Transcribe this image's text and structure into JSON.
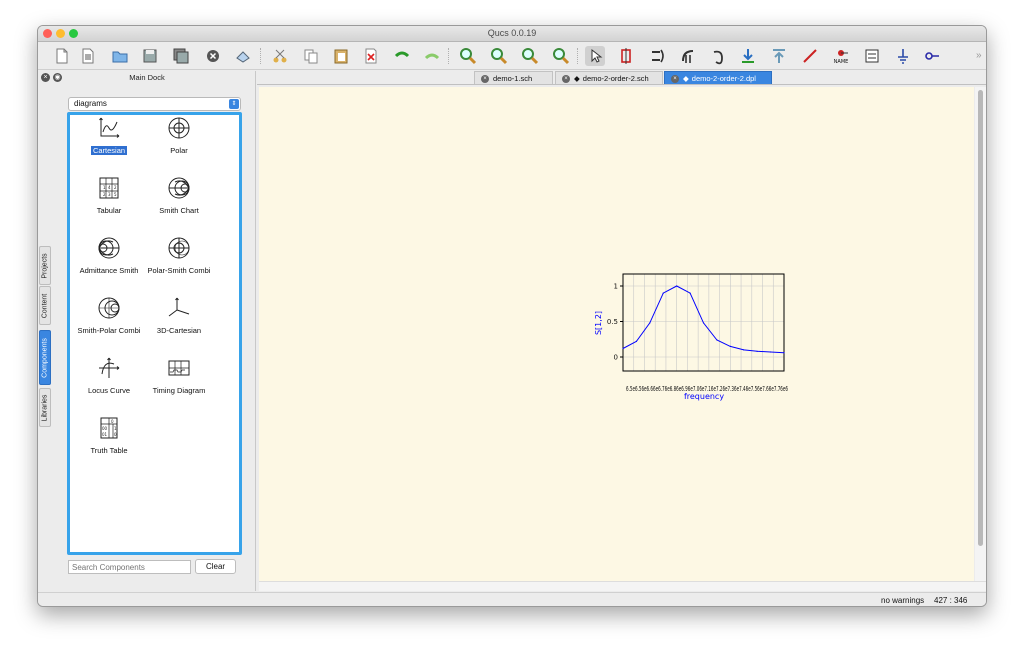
{
  "window": {
    "title": "Qucs 0.0.19"
  },
  "toolbar": {
    "icons": [
      "new-file-icon",
      "new-text-icon",
      "open-icon",
      "save-icon",
      "save-all-icon",
      "close-icon",
      "print-icon",
      "cut-icon",
      "copy-icon",
      "paste-icon",
      "delete-icon",
      "undo-icon",
      "redo-icon",
      "zoom-fit-icon",
      "zoom-1to1-icon",
      "zoom-in-icon",
      "zoom-out-icon",
      "select-icon",
      "port-icon",
      "mirror-x-icon",
      "mirror-y-icon",
      "rotate-icon",
      "enter-subcircuit-icon",
      "exit-subcircuit-icon",
      "wire-icon",
      "name-icon",
      "label-icon",
      "ground-icon",
      "port-symbol-icon"
    ],
    "name_label": "NAME",
    "more": "»"
  },
  "dock": {
    "title": "Main Dock",
    "side_tabs": [
      "Projects",
      "Content",
      "Components",
      "Libraries"
    ],
    "active_side_tab": "Components",
    "category": "diagrams",
    "components": [
      {
        "label": "Cartesian",
        "icon": "cartesian-icon",
        "selected": true
      },
      {
        "label": "Polar",
        "icon": "polar-icon",
        "selected": false
      },
      {
        "label": "Tabular",
        "icon": "tabular-icon",
        "selected": false
      },
      {
        "label": "Smith Chart",
        "icon": "smith-chart-icon",
        "selected": false
      },
      {
        "label": "Admittance Smith",
        "icon": "admittance-smith-icon",
        "selected": false
      },
      {
        "label": "Polar-Smith Combi",
        "icon": "polar-smith-icon",
        "selected": false
      },
      {
        "label": "Smith-Polar Combi",
        "icon": "smith-polar-icon",
        "selected": false
      },
      {
        "label": "3D-Cartesian",
        "icon": "3d-cartesian-icon",
        "selected": false
      },
      {
        "label": "Locus Curve",
        "icon": "locus-curve-icon",
        "selected": false
      },
      {
        "label": "Timing Diagram",
        "icon": "timing-diagram-icon",
        "selected": false
      },
      {
        "label": "Truth Table",
        "icon": "truth-table-icon",
        "selected": false
      }
    ],
    "search_placeholder": "Search Components",
    "clear_label": "Clear"
  },
  "tabs": [
    {
      "label": "demo-1.sch",
      "active": false
    },
    {
      "label": "demo-2-order-2.sch",
      "active": false
    },
    {
      "label": "demo-2-order-2.dpl",
      "active": true
    }
  ],
  "status": {
    "warnings": "no warnings",
    "coords": "427 : 346"
  },
  "colors": {
    "accent": "#3a86e0",
    "canvas": "#fdf8e4",
    "trace": "#0000ff",
    "list_border": "#37a3ea"
  },
  "chart_data": {
    "type": "line",
    "series": [
      {
        "name": "S[1,2]",
        "x": [
          6.5,
          6.6,
          6.7,
          6.8,
          6.9,
          7.0,
          7.1,
          7.2,
          7.3,
          7.4,
          7.5,
          7.6,
          7.7
        ],
        "values": [
          0.12,
          0.22,
          0.48,
          0.9,
          1.0,
          0.9,
          0.48,
          0.24,
          0.15,
          0.1,
          0.08,
          0.07,
          0.06
        ]
      }
    ],
    "xlabel": "frequency",
    "ylabel": "S[1,2]",
    "y_ticks": [
      "0",
      "0.5",
      "1"
    ],
    "x_tick_text": "6.5e6.56e6.66e6.76e6.86e6.96e7.06e7.16e7.26e7.36e7.46e7.56e7.66e7.76e6",
    "ylim": [
      0,
      1
    ],
    "grid": true
  }
}
